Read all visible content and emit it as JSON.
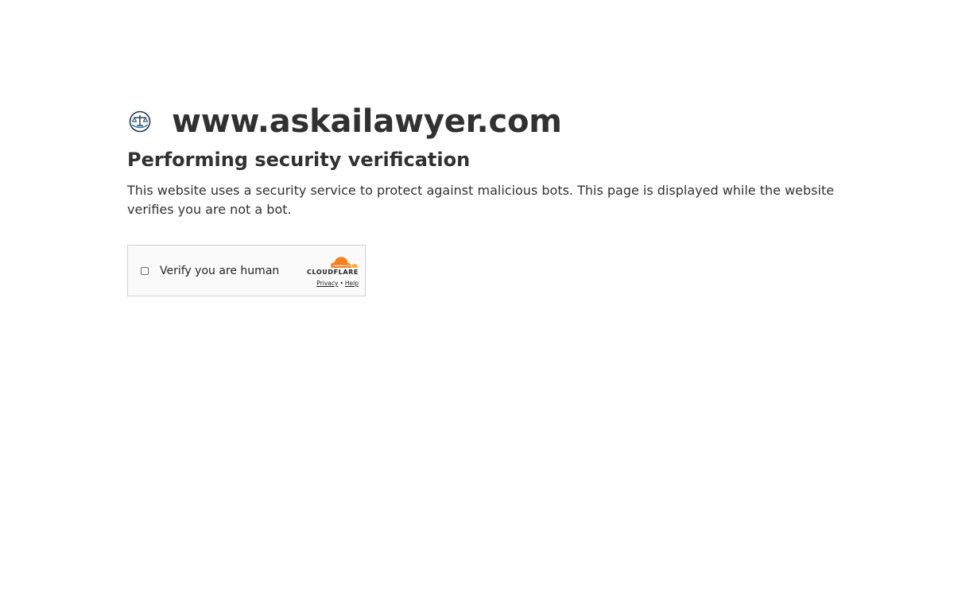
{
  "site": {
    "domain": "www.askailawyer.com",
    "logo_icon": "scales-of-justice-icon"
  },
  "main": {
    "heading": "Performing security verification",
    "description": "This website uses a security service to protect against malicious bots. This page is displayed while the website verifies you are not a bot."
  },
  "challenge": {
    "checkbox_label": "Verify you are human",
    "checked": false,
    "provider": "CLOUDFLARE",
    "provider_icon": "cloudflare-cloud-icon",
    "privacy_label": "Privacy",
    "separator": "•",
    "help_label": "Help"
  },
  "colors": {
    "text": "#313131",
    "cloudflare_orange": "#f48120",
    "cloudflare_light_orange": "#faae40",
    "logo_navy": "#1f3a5a"
  }
}
